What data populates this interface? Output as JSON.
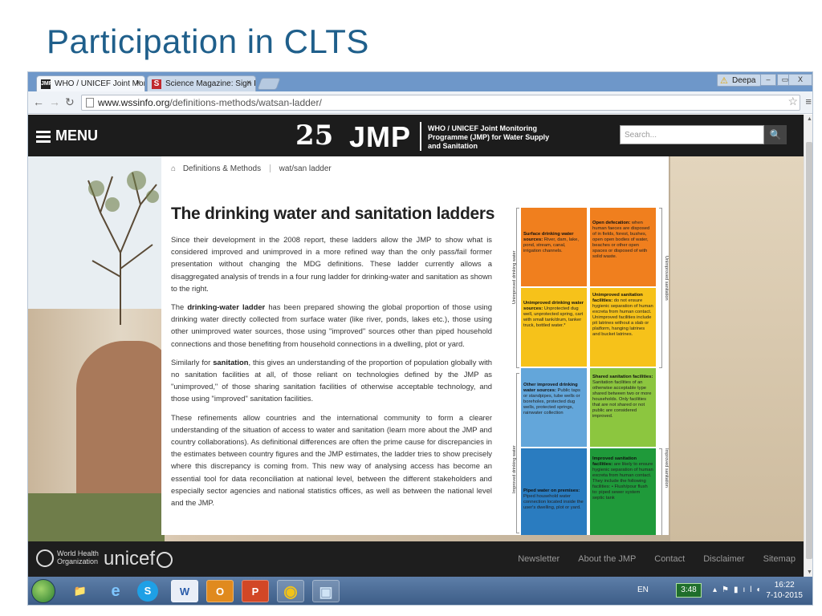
{
  "slide": {
    "title": "Participation in CLTS"
  },
  "browser": {
    "tabs": [
      {
        "label": "WHO / UNICEF Joint Mon",
        "favicon": "JMP",
        "close": "×"
      },
      {
        "label": "Science Magazine: Sign In",
        "favicon": "S",
        "close": "×"
      }
    ],
    "user": "Deepa",
    "window_controls": {
      "minimize": "–",
      "restore": "▭",
      "close": "X"
    },
    "url_host": "www.wssinfo.org",
    "url_path": "/definitions-methods/watsan-ladder/"
  },
  "site": {
    "menu_label": "MENU",
    "logo_25": "25",
    "logo_jmp": "JMP",
    "logo_desc": "WHO / UNICEF Joint Monitoring Programme (JMP) for Water Supply and Sanitation",
    "search_placeholder": "Search...",
    "search_button": "🔍"
  },
  "breadcrumb": {
    "home_icon": "⌂",
    "items": [
      "Definitions & Methods",
      "wat/san ladder"
    ]
  },
  "article": {
    "title": "The drinking water and sanitation ladders",
    "p1": "Since their development in the 2008 report, these ladders allow the JMP to show what is considered improved and unimproved in a more refined way than the only pass/fail former presentation without changing the MDG definitions. These ladder currently allows a disaggregated analysis of trends in a four rung ladder for drinking-water and sanitation as shown to the right.",
    "p2_pre": "The ",
    "p2_bold": "drinking-water ladder",
    "p2_post": " has been prepared showing the global proportion of those using drinking water directly collected from surface water (like river, ponds, lakes etc.), those using other unimproved water sources, those using \"improved\" sources other than piped household connections and those benefiting from household connections in a dwelling, plot or yard.",
    "p3_pre": "Similarly for ",
    "p3_bold": "sanitation",
    "p3_post": ", this gives an understanding of the proportion of population globally with no sanitation facilities at all, of those reliant on technologies defined by the JMP as \"unimproved,\" of those sharing sanitation facilities of otherwise acceptable technology, and those using \"improved\" sanitation facilities.",
    "p4": "These refinements allow countries and the international community to form a clearer understanding of the situation of access to water and sanitation (learn more about the JMP and country collaborations). As definitional differences are often the prime cause for discrepancies in the estimates between country figures and the JMP estimates, the ladder tries to show precisely where this discrepancy is coming from. This new way of analysing access has become an essential tool for data reconciliation at national level, between the different stakeholders and especially sector agencies and national statistics offices, as well as between the national level and the JMP."
  },
  "ladder": {
    "left_labels": {
      "top": "Unimproved drinking water",
      "bottom": "Improved drinking water"
    },
    "right_labels": {
      "top": "Unimproved sanitation",
      "bottom": "Improved sanitation"
    },
    "water": [
      {
        "title": "Surface drinking water sources:",
        "text": " River, dam, lake, pond, stream, canal, irrigation channels.",
        "color": "#f07f1e"
      },
      {
        "title": "Unimproved drinking water sources:",
        "text": " Unprotected dug well, unprotected spring, cart with small tank/drum, tanker truck, bottled water.*",
        "color": "#f6c21a"
      },
      {
        "title": "Other improved drinking water sources:",
        "text": " Public taps or standpipes, tube wells or boreholes, protected dug wells, protected springs, rainwater collection",
        "color": "#63a6da"
      },
      {
        "title": "Piped water on premises:",
        "text": " Piped household water connection located inside the user's dwelling, plot or yard.",
        "color": "#2a7cc0"
      }
    ],
    "sanitation": [
      {
        "title": "Open defecation:",
        "text": " when human faeces are disposed of in fields, forest, bushes, open open bodies of water, beaches or other open spaces or disposed of with solid waste.",
        "color": "#f07f1e"
      },
      {
        "title": "Unimproved sanitation facilities:",
        "text": " do not ensure hygienic separation of human excreta from human contact. Unimproved facilities include pit latrines without a slab or platform, hanging latrines and bucket latrines.",
        "color": "#f6c21a"
      },
      {
        "title": "Shared sanitation facilities:",
        "text": " Sanitation facilities of an otherwise acceptable type shared between two or more households. Only facilities that are not shared or not public are considered improved.",
        "color": "#8cc63f"
      },
      {
        "title": "Improved sanitation facilities:",
        "text": " are likely to ensure hygienic separation of human excreta from human contact. They include the following facilities: • Flush/pour flush to: piped sewer system septic tank",
        "color": "#1f9a3a"
      }
    ]
  },
  "footer": {
    "who": "World Health Organization",
    "unicef": "unicef",
    "links": [
      "Newsletter",
      "About the JMP",
      "Contact",
      "Disclaimer",
      "Sitemap"
    ]
  },
  "taskbar": {
    "apps": [
      {
        "name": "explorer",
        "glyph": "📁"
      },
      {
        "name": "ie",
        "glyph": "e"
      },
      {
        "name": "skype",
        "glyph": "S"
      },
      {
        "name": "word",
        "glyph": "W"
      },
      {
        "name": "outlook",
        "glyph": "O"
      },
      {
        "name": "powerpoint",
        "glyph": "P"
      },
      {
        "name": "chrome",
        "glyph": "◉"
      },
      {
        "name": "remote-desktop",
        "glyph": "▣"
      }
    ],
    "lang": "EN",
    "battery_time": "3:48",
    "time": "16:22",
    "date": "7-10-2015"
  },
  "colors": {
    "title_blue": "#1f5f8b",
    "header_bg": "#1c1c1c"
  }
}
